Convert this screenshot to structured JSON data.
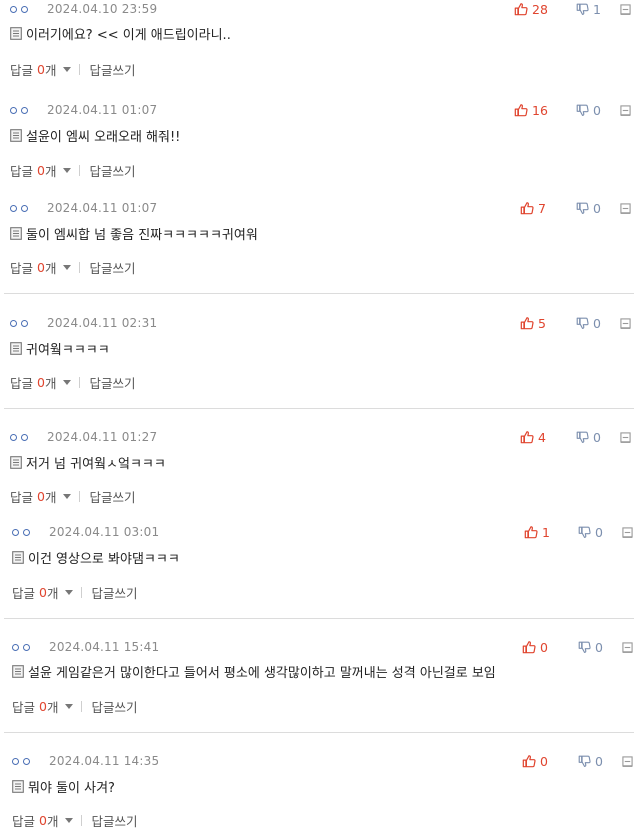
{
  "labels": {
    "reply": "답글",
    "reply_unit": "개",
    "write_reply": "답글쓰기"
  },
  "colors": {
    "up": "#e0452f",
    "down": "#7c8fae",
    "user_dot": "#4a6fb5"
  },
  "icons": {
    "user": "user-dots-icon",
    "doc": "document-icon",
    "up": "thumbs-up-icon",
    "down": "thumbs-down-icon",
    "report": "report-icon"
  },
  "comments": [
    {
      "date": "2024.04.10 23:59",
      "text": "이러기에요? << 이게 애드립이라니..",
      "up": "28",
      "down": "1",
      "replies": "0"
    },
    {
      "date": "2024.04.11 01:07",
      "text": "설윤이 엠씨 오래오래 해줘!!",
      "up": "16",
      "down": "0",
      "replies": "0"
    },
    {
      "date": "2024.04.11 01:07",
      "text": "둘이 엠씨합 넘 좋음 진짜ㅋㅋㅋㅋㅋ귀여워",
      "up": "7",
      "down": "0",
      "replies": "0"
    },
    {
      "date": "2024.04.11 02:31",
      "text": "귀여웤ㅋㅋㅋㅋ",
      "up": "5",
      "down": "0",
      "replies": "0"
    },
    {
      "date": "2024.04.11 01:27",
      "text": "저거 넘 귀여웤ㅅ엌ㅋㅋㅋ",
      "up": "4",
      "down": "0",
      "replies": "0"
    },
    {
      "date": "2024.04.11 03:01",
      "text": "이건 영상으로 봐야댐ㅋㅋㅋ",
      "up": "1",
      "down": "0",
      "replies": "0"
    },
    {
      "date": "2024.04.11 15:41",
      "text": "설윤 게임같은거 많이한다고 들어서 평소에 생각많이하고 말꺼내는 성격 아닌걸로 보임",
      "up": "0",
      "down": "0",
      "replies": "0"
    },
    {
      "date": "2024.04.11 14:35",
      "text": "뭐야 둘이 사겨?",
      "up": "0",
      "down": "0",
      "replies": "0"
    }
  ]
}
